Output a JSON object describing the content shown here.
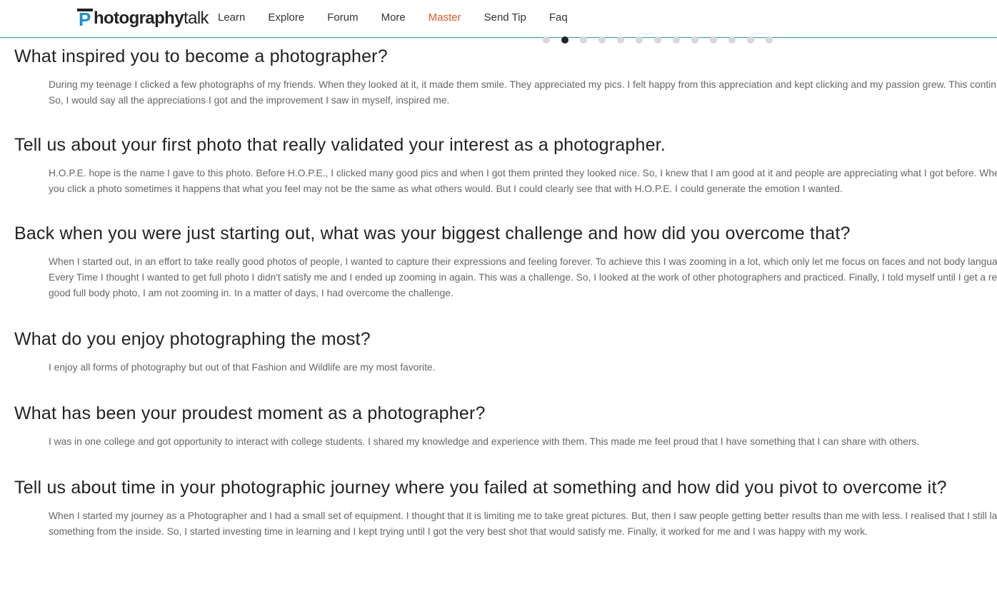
{
  "header": {
    "logo_text_a": "hotography",
    "logo_text_b": "talk",
    "logo_mark": "P",
    "nav": [
      "Learn",
      "Explore",
      "Forum",
      "More",
      "Master",
      "Send Tip",
      "Faq"
    ],
    "active_nav": "Master",
    "active_color": "#e8562a"
  },
  "carousel": {
    "dot_count": 13,
    "active_index": 1
  },
  "qa": [
    {
      "question": "What inspired you to become a photographer?",
      "answer": "During my teenage I clicked a few photographs of my friends. When they looked at it, it made them smile. They appreciated my pics. I felt happy from this appreciation and kept clicking and my passion grew. This continued. So, I would say all the appreciations I got and the improvement I saw in myself, inspired me."
    },
    {
      "question": "Tell us about your first photo that really validated your interest as a photographer.",
      "answer": "H.O.P.E. hope is the name I gave to this photo. Before H.O.P.E., I clicked many good pics and when I got them printed they looked nice. So, I knew that I am good at it and people are appreciating what I got before. When you click a photo sometimes it happens that what you feel may not be the same as what others would. But I could clearly see that with H.O.P.E. I could generate the emotion I wanted."
    },
    {
      "question": "Back when you were just starting out, what was your biggest challenge and how did you overcome that?",
      "answer": "When I started out, in an effort to take really good photos of people, I wanted to capture their expressions and feeling forever. To achieve this I was zooming in a lot, which only let me focus on faces and not body language. Every Time I thought I wanted to get full photo I didn't satisfy me and I ended up zooming in again. This was a challenge. So, I looked at the work of other photographers and practiced. Finally, I told myself until I get a really good full body photo, I am not zooming in. In a matter of days, I had overcome the challenge."
    },
    {
      "question": "What do you enjoy photographing the most?",
      "answer": "I enjoy all forms of photography but out of that Fashion and Wildlife are my most favorite."
    },
    {
      "question": "What has been your proudest moment as a photographer?",
      "answer": "I was in one college and got opportunity to interact with college students. I shared my knowledge and experience with them. This made me feel proud that I have something that I can share with others."
    },
    {
      "question": "Tell us about time in your photographic journey where you failed at something and how did you pivot to overcome it?",
      "answer": "When I started my journey as a Photographer and I had a small set of equipment. I thought that it is limiting me to take great pictures. But, then I saw people getting better results than me with less. I realised that I still lack something from the inside. So, I started investing time in learning and I kept trying until I got the very best shot that would satisfy me. Finally, it worked for me and I was happy with my work."
    }
  ]
}
